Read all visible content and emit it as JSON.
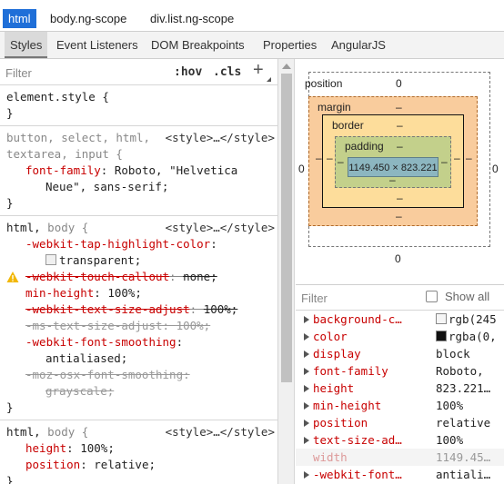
{
  "breadcrumb": [
    "html",
    "body.ng-scope",
    "div.list.ng-scope"
  ],
  "tabs": [
    "Styles",
    "Event Listeners",
    "DOM Breakpoints",
    "Properties",
    "AngularJS"
  ],
  "styles_filter": {
    "placeholder": "Filter",
    "hov": ":hov",
    "cls": ".cls",
    "add": "+"
  },
  "rules": {
    "r0": {
      "selector": "element.style {",
      "close": "}"
    },
    "r1": {
      "sel1": "button, select, html,",
      "sel2": "textarea, input {",
      "source": "<style>…</style>",
      "p1_name": "font-family",
      "p1_val": "Roboto, \"Helvetica",
      "p1_val2": "Neue\", sans-serif;",
      "close": "}"
    },
    "r2": {
      "sel_a": "html,",
      "sel_b": "body {",
      "source": "<style>…</style>",
      "p1_name": "-webkit-tap-highlight-color",
      "p1_val": "transparent;",
      "p2_name": "-webkit-touch-callout",
      "p2_val": "none;",
      "p3_name": "min-height",
      "p3_val": "100%;",
      "p4_name": "-webkit-text-size-adjust",
      "p4_val": "100%;",
      "p5_name": "-ms-text-size-adjust",
      "p5_val": "100%;",
      "p6_name": "-webkit-font-smoothing",
      "p6_val": "antialiased;",
      "p7_name": "-moz-osx-font-smoothing",
      "p7_val": "grayscale;",
      "close": "}"
    },
    "r3": {
      "sel_a": "html,",
      "sel_b": "body {",
      "source": "<style>…</style>",
      "p1_name": "height",
      "p1_val": "100%;",
      "p2_name": "position",
      "p2_val": "relative;",
      "close": "}"
    }
  },
  "box_model": {
    "position_label": "position",
    "position_value": "0",
    "margin_label": "margin",
    "margin_value": "–",
    "border_label": "border",
    "border_value": "–",
    "padding_label": "padding",
    "padding_value": "–",
    "content_size": "1149.450 × 823.221",
    "side_zero": "0",
    "dash": "–"
  },
  "computed_filter": {
    "placeholder": "Filter",
    "show_all": "Show all"
  },
  "computed": [
    {
      "name": "background-c…",
      "value": "rgb(245",
      "swatch": "#f5f5f5"
    },
    {
      "name": "color",
      "value": "rgba(0,",
      "swatch": "#111111"
    },
    {
      "name": "display",
      "value": "block"
    },
    {
      "name": "font-family",
      "value": "Roboto,"
    },
    {
      "name": "height",
      "value": "823.221…"
    },
    {
      "name": "min-height",
      "value": "100%"
    },
    {
      "name": "position",
      "value": "relative"
    },
    {
      "name": "text-size-ad…",
      "value": "100%"
    },
    {
      "name": "width",
      "value": "1149.45…",
      "inherited": true
    },
    {
      "name": "-webkit-font…",
      "value": "antiali…"
    }
  ]
}
